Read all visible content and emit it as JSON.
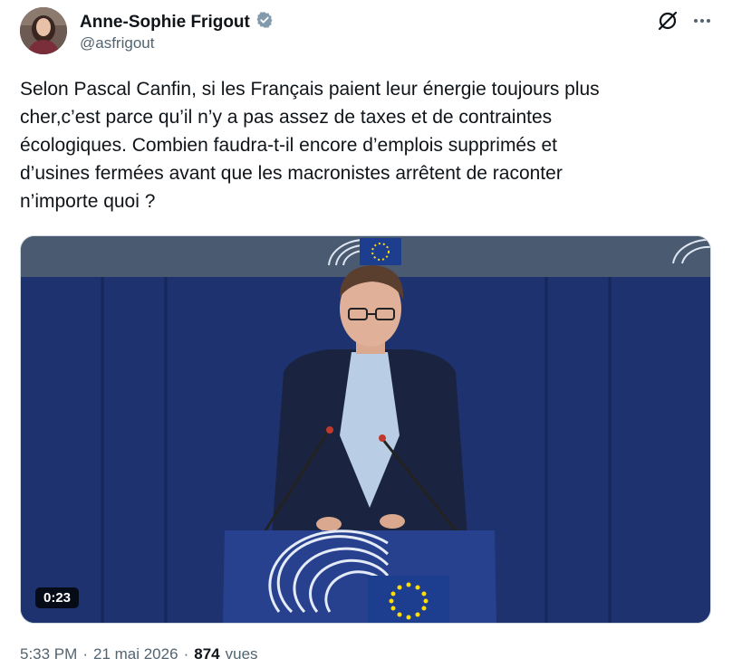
{
  "author": {
    "name": "Anne-Sophie Frigout",
    "handle": "@asfrigout",
    "verified": true
  },
  "icons": {
    "verified": "verified-badge-icon",
    "grok": "grok-icon",
    "more": "more-options-icon",
    "play": "video-player"
  },
  "tweet": {
    "text": "Selon Pascal Canfin, si les Français paient leur énergie toujours plus\ncher,c’est parce qu’il n’y a pas assez de taxes et de contraintes\nécologiques. Combien faudra-t-il encore d’emplois supprimés et\nd’usines fermées avant que les macronistes arrêtent de raconter\nn’importe quoi ?"
  },
  "media": {
    "duration": "0:23"
  },
  "meta": {
    "time": "5:33 PM",
    "separator": "·",
    "date": "21 mai 2026",
    "views_count": "874",
    "views_label": "vues"
  },
  "colors": {
    "text": "#0f1419",
    "secondary": "#536471",
    "verified": "#829aab",
    "eu_blue": "#1d3d8f",
    "eu_star": "#ffdd00"
  }
}
